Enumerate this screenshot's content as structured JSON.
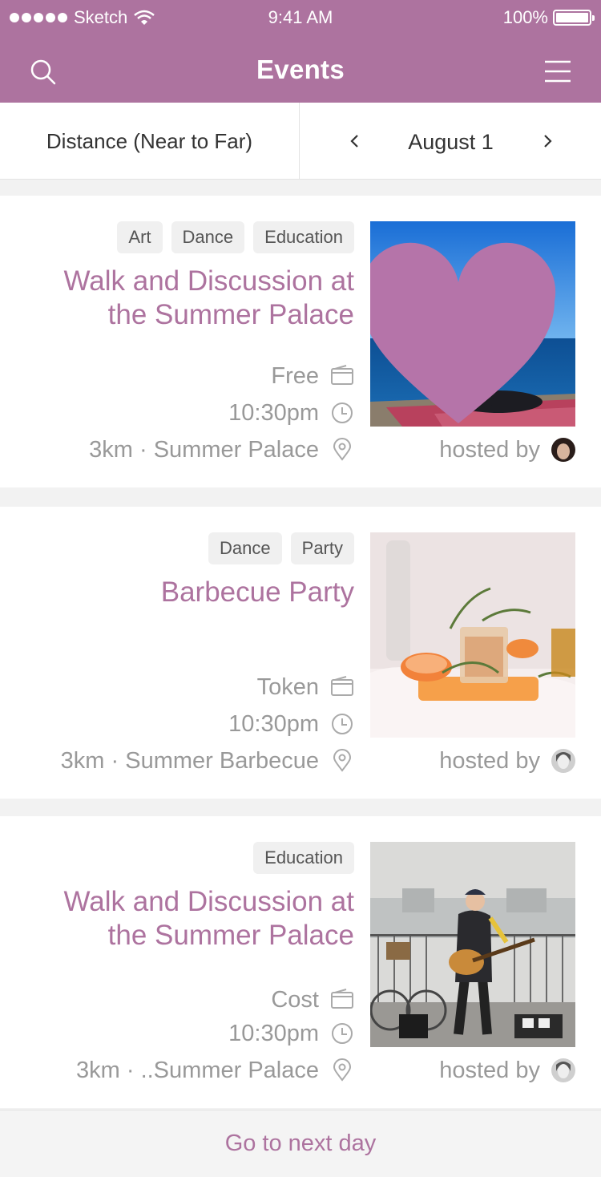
{
  "status_bar": {
    "carrier": "Sketch",
    "time": "9:41 AM",
    "battery": "100%"
  },
  "header": {
    "title": "Events",
    "search_icon": "search-icon",
    "menu_icon": "menu-icon"
  },
  "filter": {
    "sort_label": "Distance (Near to Far)",
    "date": "August 1"
  },
  "colors": {
    "accent": "#ad739f",
    "muted_text": "#999999",
    "tag_bg": "#f0f0f0"
  },
  "events": [
    {
      "tags": [
        "Art",
        "Dance",
        "Education"
      ],
      "title": "Walk and Discussion at the Summer Palace",
      "price": "Free",
      "time": "10:30pm",
      "location": "3km · Summer Palace",
      "hosted_by": "hosted by",
      "favorited": true
    },
    {
      "tags": [
        "Dance",
        "Party"
      ],
      "title": "Barbecue Party",
      "price": "Token",
      "time": "10:30pm",
      "location": "3km · Summer Barbecue",
      "hosted_by": "hosted by",
      "favorited": false
    },
    {
      "tags": [
        "Education"
      ],
      "title": "Walk and Discussion at the Summer Palace",
      "price": "Cost",
      "time": "10:30pm",
      "location": "3km · ..Summer Palace",
      "hosted_by": "hosted by",
      "favorited": false
    }
  ],
  "footer": {
    "next_day_label": "Go to next day"
  }
}
